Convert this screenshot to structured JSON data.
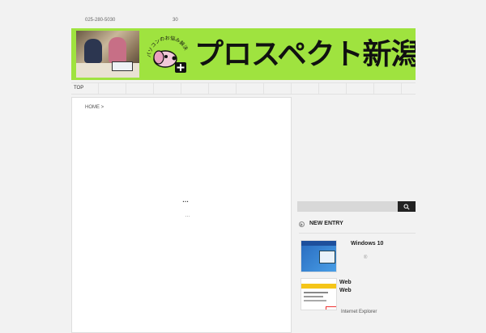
{
  "header": {
    "phone": "025-280-5030",
    "hours": "30",
    "brand_text": "プロスペクト新潟",
    "mascot_arc_text": "パソコンのお悩み解決"
  },
  "nav": {
    "items": [
      {
        "label": "TOP"
      }
    ]
  },
  "breadcrumb": {
    "home": "HOME",
    "separator": ">"
  },
  "main": {
    "line1": "…",
    "line2": "…"
  },
  "sidebar": {
    "search": {
      "placeholder": "",
      "button_icon": "search-icon"
    },
    "new_entry": {
      "title": "NEW ENTRY",
      "entries": [
        {
          "title": "Windows 10",
          "meta": "®"
        },
        {
          "title": "Web\nWeb",
          "sub": "Internet Explorer"
        }
      ]
    }
  },
  "colors": {
    "banner_green": "#9fe33f",
    "search_button": "#222222",
    "page_bg": "#f2f2f2"
  }
}
